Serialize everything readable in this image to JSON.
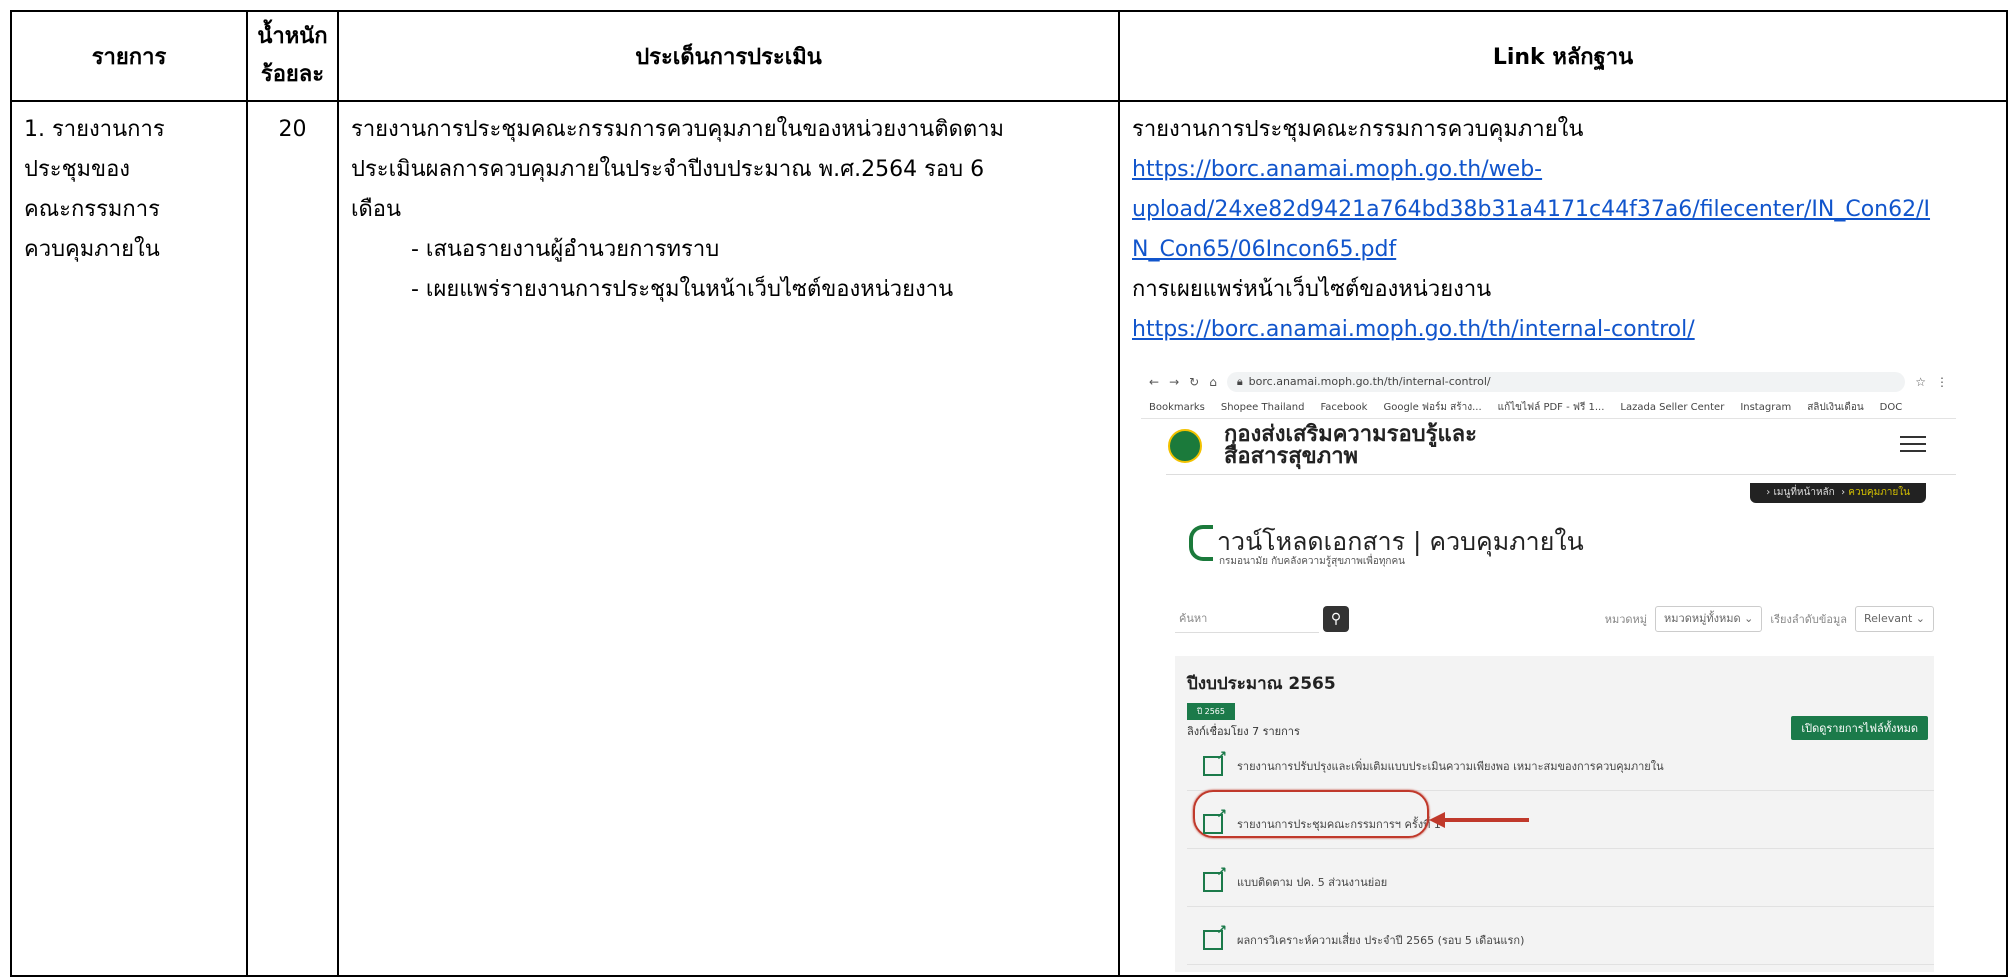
{
  "table": {
    "headers": {
      "col1": "รายการ",
      "col2_line1": "น้ำหนัก",
      "col2_line2": "ร้อยละ",
      "col3": "ประเด็นการประเมิน",
      "col4": "Link หลักฐาน"
    },
    "row": {
      "item_lines": [
        "1. รายงานการ",
        "ประชุมของ",
        "คณะกรรมการ",
        "ควบคุมภายใน"
      ],
      "weight": "20",
      "issue_lines": [
        "รายงานการประชุมคณะกรรมการควบคุมภายในของหน่วยงานติดตาม",
        "ประเมินผลการควบคุมภายในประจำปีงบประมาณ พ.ศ.2564 รอบ 6",
        "เดือน"
      ],
      "issue_bullets": [
        "- เสนอรายงานผู้อำนวยการทราบ",
        "- เผยแพร่รายงานการประชุมในหน้าเว็บไซต์ของหน่วยงาน"
      ],
      "evidence": {
        "label1": "รายงานการประชุมคณะกรรมการควบคุมภายใน",
        "link1_lines": [
          "https://borc.anamai.moph.go.th/web-",
          "upload/24xe82d9421a764bd38b31a4171c44f37a6/filecenter/IN_Con62/I",
          "N_Con65/06Incon65.pdf"
        ],
        "label2": "การเผยแพร่หน้าเว็บไซต์ของหน่วยงาน",
        "link2": "https://borc.anamai.moph.go.th/th/internal-control/"
      }
    }
  },
  "screenshot": {
    "url": "borc.anamai.moph.go.th/th/internal-control/",
    "bookmarks": [
      "Bookmarks",
      "Shopee Thailand",
      "Facebook",
      "Google ฟอร์ม สร้าง...",
      "แก้ไขไฟล์ PDF - ฟรี 1...",
      "Lazada Seller Center",
      "Instagram",
      "สลิปเงินเดือน",
      "DOC"
    ],
    "site_title_line1": "กองส่งเสริมความรอบรู้และ",
    "site_title_line2": "สื่อสารสุขภาพ",
    "breadcrumb_home": "เมนูที่หน้าหลัก",
    "breadcrumb_current": "ควบคุมภายใน",
    "download_title": "าวน์โหลดเอกสาร | ควบคุมภายใน",
    "download_sub": "กรมอนามัย กับคลังความรู้สุขภาพเพื่อทุกคน",
    "search_placeholder": "ค้นหา",
    "filter_category_label": "หมวดหมู่",
    "filter_category_value": "หมวดหมู่ทั้งหมด",
    "filter_sort_label": "เรียงลำดับข้อมูล",
    "filter_sort_value": "Relevant",
    "year_heading": "ปีงบประมาณ 2565",
    "year_tag": "ปี 2565",
    "link_count": "ลิงก์เชื่อมโยง 7 รายการ",
    "open_all_button": "เปิดดูรายการไฟล์ทั้งหมด",
    "items": [
      "รายงานการปรับปรุงและเพิ่มเติมแบบประเมินความเพียงพอ เหมาะสมของการควบคุมภายใน",
      "รายงานการประชุมคณะกรรมการฯ ครั้งที่ 1",
      "แบบติดตาม ปค. 5 ส่วนงานย่อย",
      "ผลการวิเคราะห์ความเสี่ยง ประจำปี 2565 (รอบ 5 เดือนแรก)"
    ],
    "colors": {
      "brand_green": "#1b7a4a",
      "highlight_red": "#c0392b"
    }
  }
}
